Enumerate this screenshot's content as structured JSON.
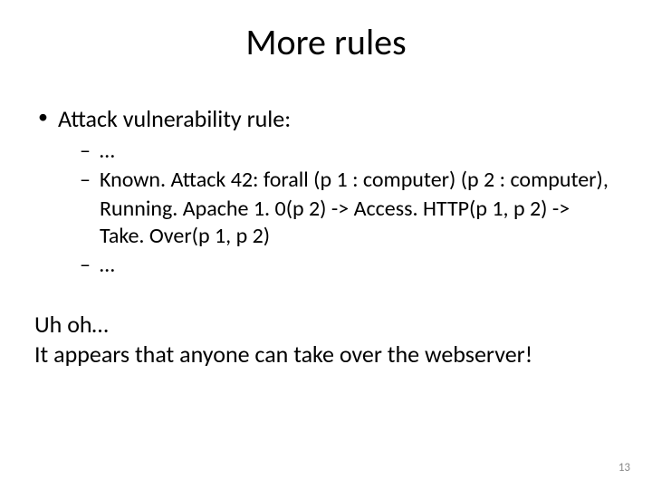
{
  "slide": {
    "title": "More rules",
    "bullets": {
      "l1_attack": "Attack vulnerability rule:",
      "l2_ellipsis1": "…",
      "l2_known": "Known. Attack 42: forall (p 1 : computer) (p 2 : computer),",
      "l2_known_cont1": " Running. Apache 1. 0(p 2) -> Access. HTTP(p 1, p 2) -> Take. Over(p 1, p 2)",
      "l2_ellipsis2": "…"
    },
    "closing": {
      "line1": "Uh oh…",
      "line2": "It appears that anyone can take over the webserver!"
    },
    "page_number": "13"
  }
}
